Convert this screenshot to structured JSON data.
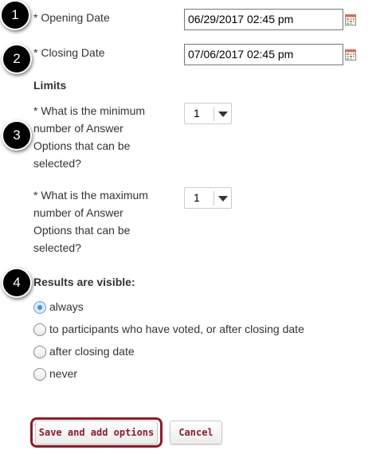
{
  "step_badges": [
    "1",
    "2",
    "3",
    "4"
  ],
  "opening": {
    "label": "* Opening Date",
    "value": "06/29/2017 02:45 pm",
    "icon": "calendar-icon"
  },
  "closing": {
    "label": "* Closing Date",
    "value": "07/06/2017 02:45 pm",
    "icon": "calendar-icon"
  },
  "limits": {
    "heading": "Limits",
    "min": {
      "lines": [
        "* What is the minimum",
        "number of Answer",
        "Options that can be",
        "selected?"
      ],
      "value": "1"
    },
    "max": {
      "lines": [
        "* What is the maximum",
        "number of Answer",
        "Options that can be",
        "selected?"
      ],
      "value": "1"
    }
  },
  "results": {
    "heading": "Results are visible:",
    "options": [
      {
        "label": "always",
        "checked": true
      },
      {
        "label": "to participants who have voted, or after closing date",
        "checked": false
      },
      {
        "label": "after closing date",
        "checked": false
      },
      {
        "label": "never",
        "checked": false
      }
    ]
  },
  "actions": {
    "save_label": "Save and add options",
    "cancel_label": "Cancel"
  },
  "colors": {
    "accent": "#8b1c2c",
    "radio_selected": "#4f8fd1"
  }
}
